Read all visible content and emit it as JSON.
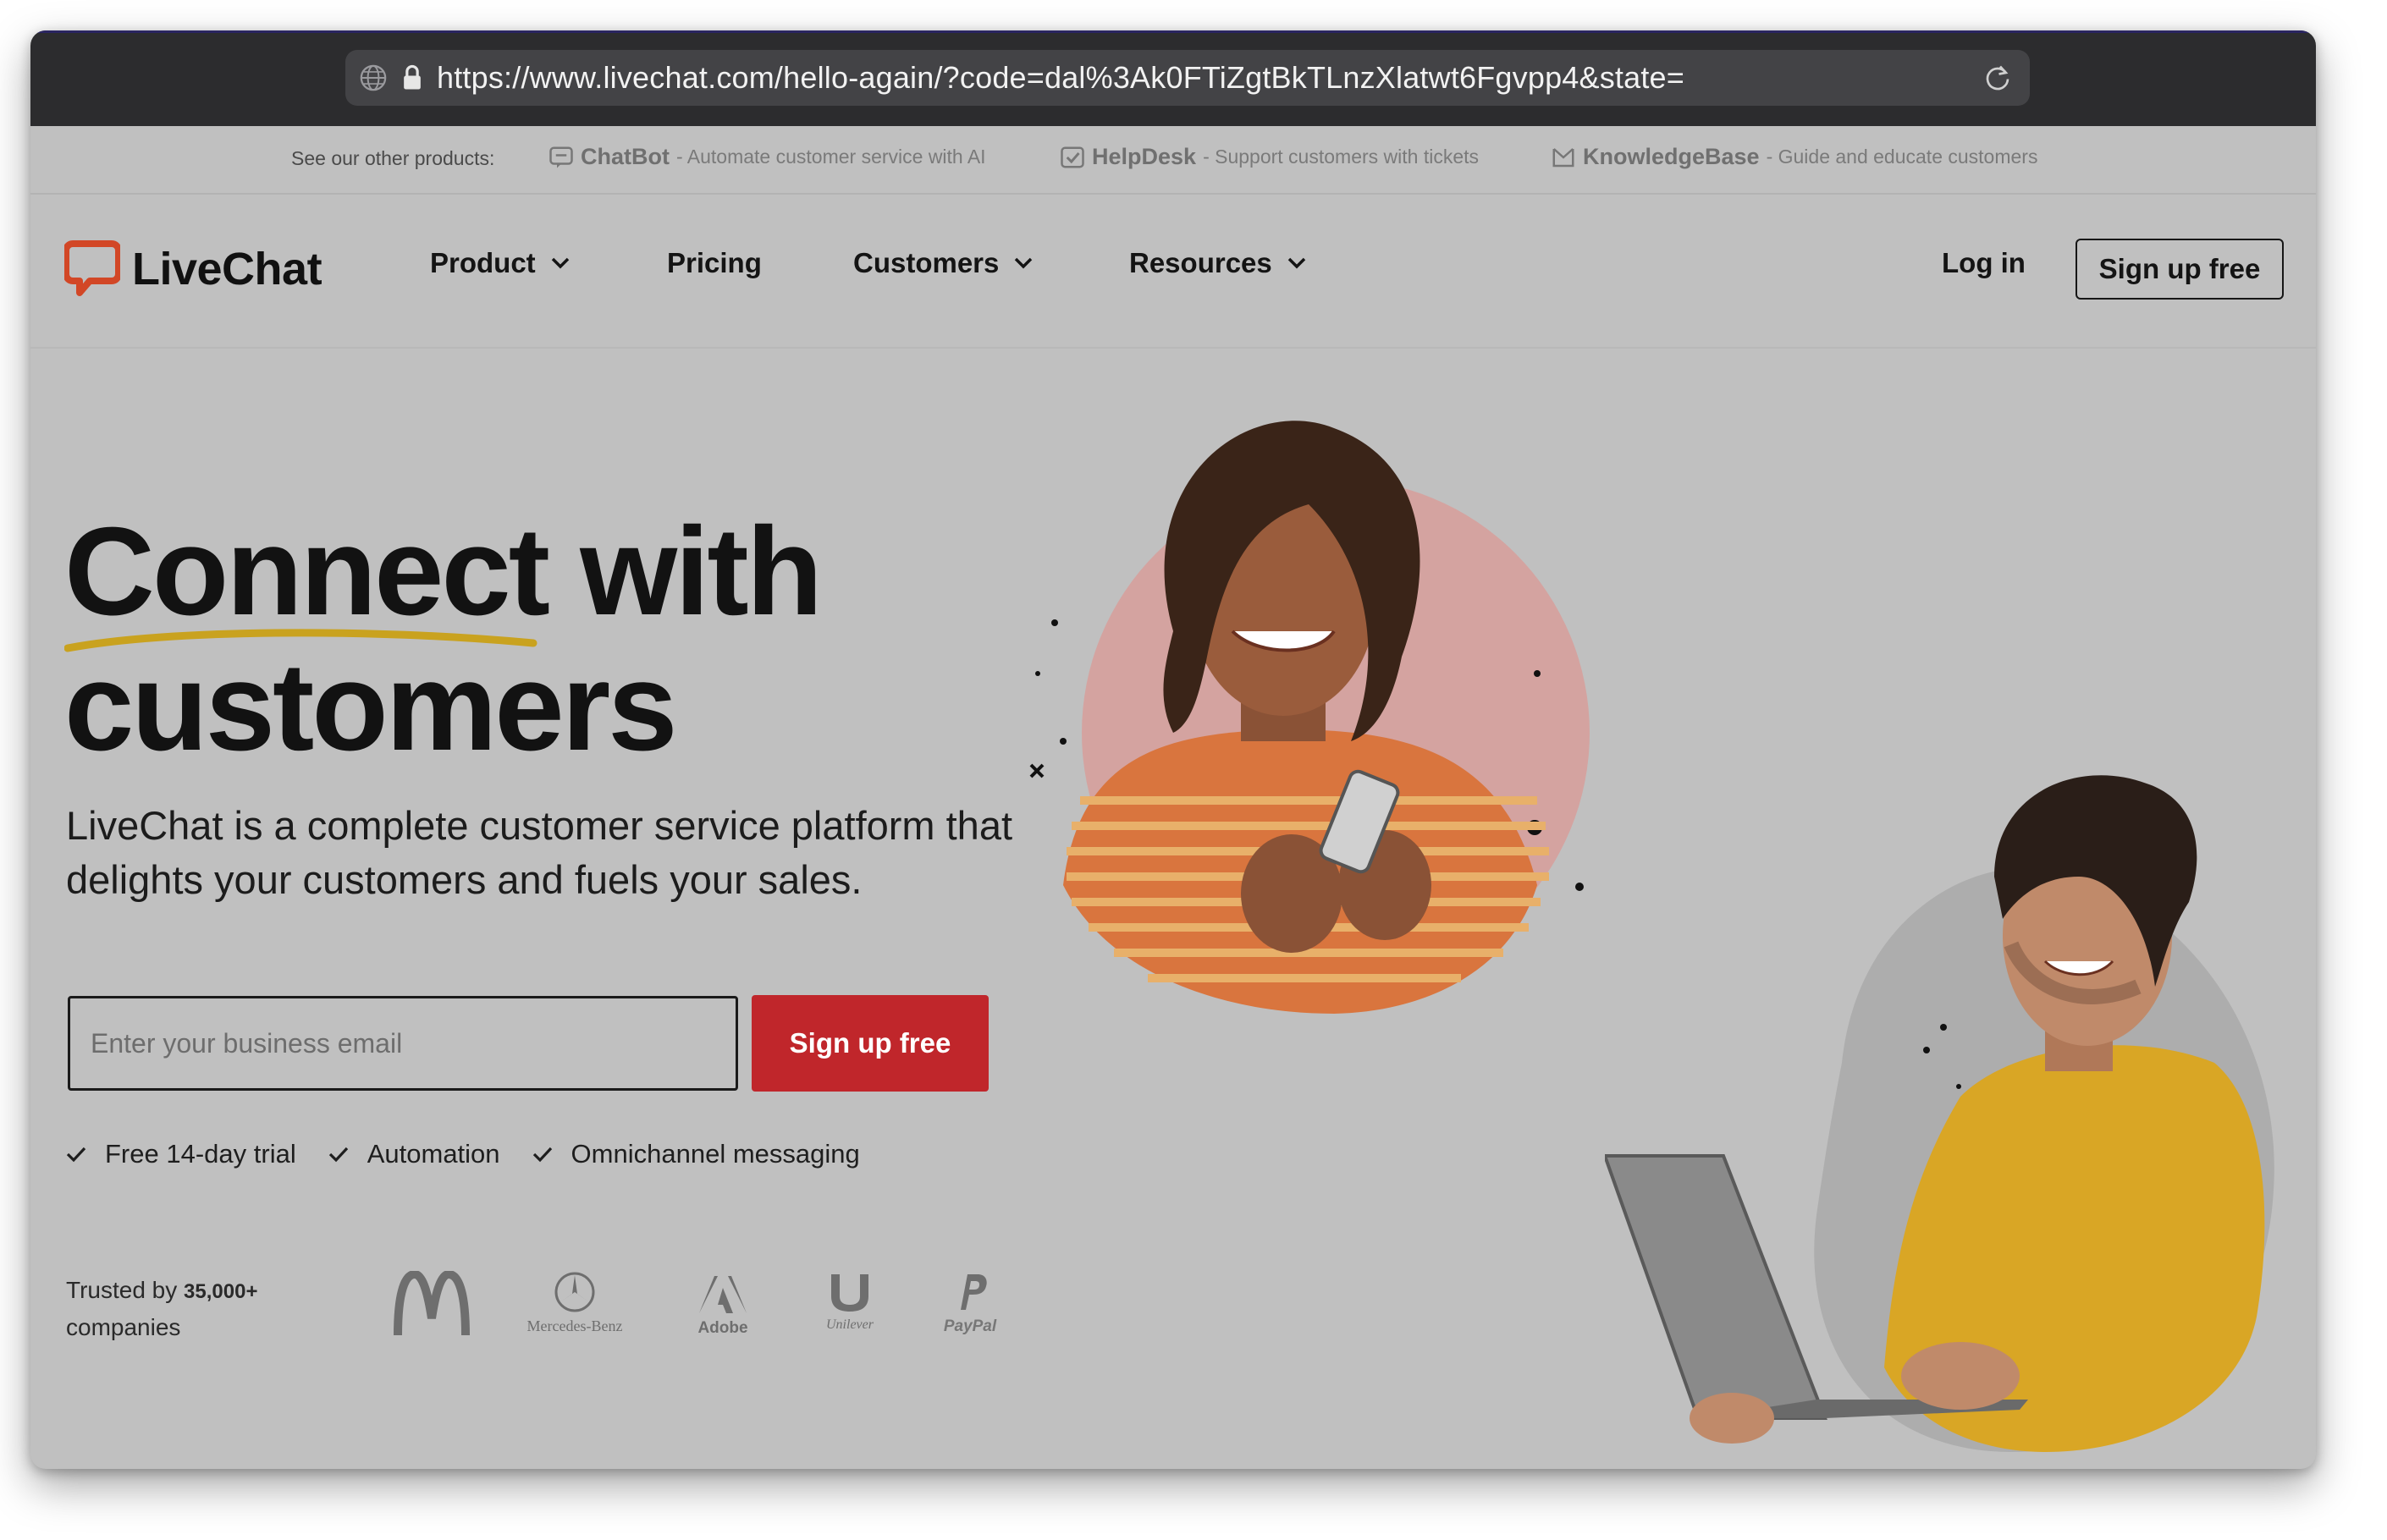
{
  "browser": {
    "url": "https://www.livechat.com/hello-again/?code=dal%3Ak0FTiZgtBkTLnzXlatwt6Fgvpp4&state="
  },
  "products_strip": {
    "label": "See our other products:",
    "items": [
      {
        "name": "ChatBot",
        "desc": "- Automate customer service with AI",
        "icon": "chatbot-icon"
      },
      {
        "name": "HelpDesk",
        "desc": "- Support customers with tickets",
        "icon": "helpdesk-icon"
      },
      {
        "name": "KnowledgeBase",
        "desc": "- Guide and educate customers",
        "icon": "knowledgebase-icon"
      }
    ]
  },
  "nav": {
    "logo": "LiveChat",
    "items": [
      {
        "label": "Product",
        "has_dropdown": true
      },
      {
        "label": "Pricing",
        "has_dropdown": false
      },
      {
        "label": "Customers",
        "has_dropdown": true
      },
      {
        "label": "Resources",
        "has_dropdown": true
      }
    ],
    "login": "Log in",
    "signup": "Sign up free"
  },
  "hero": {
    "title_line1": "Connect with",
    "title_line2": "customers",
    "subtitle": "LiveChat is a complete customer service platform that delights your customers and fuels your sales.",
    "email_placeholder": "Enter your business email",
    "cta": "Sign up free",
    "features": [
      "Free 14-day trial",
      "Automation",
      "Omnichannel messaging"
    ]
  },
  "trusted": {
    "prefix": "Trusted by",
    "count": "35,000+",
    "suffix": "companies",
    "brands": [
      "Mercedes-Benz",
      "Adobe",
      "Unilever",
      "PayPal"
    ]
  },
  "colors": {
    "accent": "#c0262b",
    "logo": "#d24726",
    "underline": "#c9a21f",
    "browser_bar": "#2c2c2e",
    "page_overlay": "#c0c0c0"
  }
}
